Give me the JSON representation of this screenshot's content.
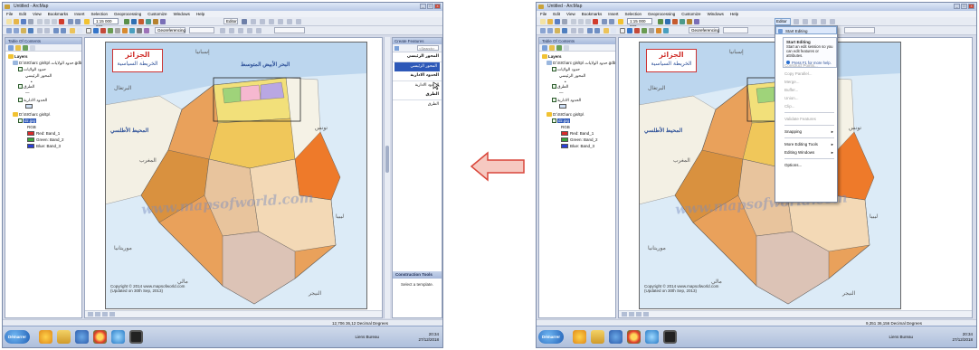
{
  "app": {
    "title": "Untitled - ArcMap",
    "menu": [
      "File",
      "Edit",
      "View",
      "Bookmarks",
      "Insert",
      "Selection",
      "Geoprocessing",
      "Customize",
      "Windows",
      "Help"
    ],
    "scale": "1:15 000 000",
    "editor_label": "Editor",
    "georef_label": "Georeferencing"
  },
  "toc": {
    "title": "Table Of Contents",
    "root": "Layers",
    "gdb": "D:\\SIG\\arc gis\\tp\\ حدود الولايات.gdb",
    "layer_roads": "حدود الولايات",
    "item_main": "المحور الرئيسي",
    "item_secondary": "الطرق",
    "item_admin": "الحدود الادارية",
    "raster_folder": "D:\\SIG\\arc gis\\tp\\",
    "raster_name": "dz.jpg",
    "rgb": "RGB",
    "bands": [
      {
        "label": "Red:   Band_1",
        "color": "#d92b2b"
      },
      {
        "label": "Green: Band_2",
        "color": "#3aa53a"
      },
      {
        "label": "Blue:  Band_3",
        "color": "#2a3fd6"
      }
    ]
  },
  "map": {
    "title_ar": "الجزائر",
    "subtitle_ar": "الخريطة السياسية",
    "sea_label": "البحر الأبيض المتوسط",
    "ocean_label": "المحيط الأطلسي",
    "spain_label": "إسبانيا",
    "portugal_label": "البرتغال",
    "morocco_label": "المغرب",
    "tunisia_label": "تونس",
    "libya_label": "ليبيا",
    "mali_label": "مالي",
    "niger_label": "النيجر",
    "mauritania_label": "موريتانيا",
    "watermark": "www.mapsofworld.com",
    "copyright_line1": "Copyright © 2014 www.mapsofworld.com",
    "copyright_line2": "(Updated on 30th Sep, 2013)"
  },
  "left": {
    "status": "12,706  36,12 Decimal Degrees"
  },
  "right": {
    "status": "9,351  36,156 Decimal Degrees",
    "editor_menu": {
      "items": [
        {
          "label": "Start Editing",
          "state": "highlight"
        },
        {
          "label": "Stop Editing",
          "state": "dim"
        },
        {
          "label": "Save Edits",
          "state": "dim"
        },
        {
          "label": "Move...",
          "state": "dim"
        },
        {
          "label": "Split...",
          "state": "dim"
        },
        {
          "label": "Construct Points...",
          "state": "dim"
        },
        {
          "label": "Copy Parallel...",
          "state": "dim"
        },
        {
          "label": "Merge...",
          "state": "dim"
        },
        {
          "label": "Buffer...",
          "state": "dim"
        },
        {
          "label": "Union...",
          "state": "dim"
        },
        {
          "label": "Clip...",
          "state": "dim"
        },
        {
          "label": "Validate Features",
          "state": "dim"
        },
        {
          "label": "Snapping",
          "state": "sub"
        },
        {
          "label": "More Editing Tools",
          "state": "sub"
        },
        {
          "label": "Editing Windows",
          "state": "sub"
        },
        {
          "label": "Options...",
          "state": "normal"
        }
      ],
      "tooltip_title": "Start Editing",
      "tooltip_text": "Start an edit session so you can edit features or attributes.",
      "tooltip_help": "Press F1 for more help."
    }
  },
  "create_features": {
    "title": "Create Features",
    "search_placeholder": "<Search>",
    "items": [
      {
        "label": "المحور الرئيسي",
        "kind": "group"
      },
      {
        "label": "المحور الرئيسي",
        "kind": "selected"
      },
      {
        "label": "الحدود الادارية",
        "kind": "group"
      },
      {
        "label": "الحدود الادارية",
        "kind": "normal"
      },
      {
        "label": "الطرق",
        "kind": "group"
      },
      {
        "label": "الطرق",
        "kind": "normal"
      }
    ],
    "construction_tools": "Construction Tools",
    "select_template": "Select a template."
  },
  "taskbar": {
    "start_label": "Démarrer",
    "lang_label": "Liens  Bureau",
    "time": "20:34",
    "date": "27/12/2018"
  },
  "colors": {
    "selection": "#2d58b8",
    "arrow_fill": "#f6c9c1",
    "arrow_stroke": "#d9463a"
  }
}
